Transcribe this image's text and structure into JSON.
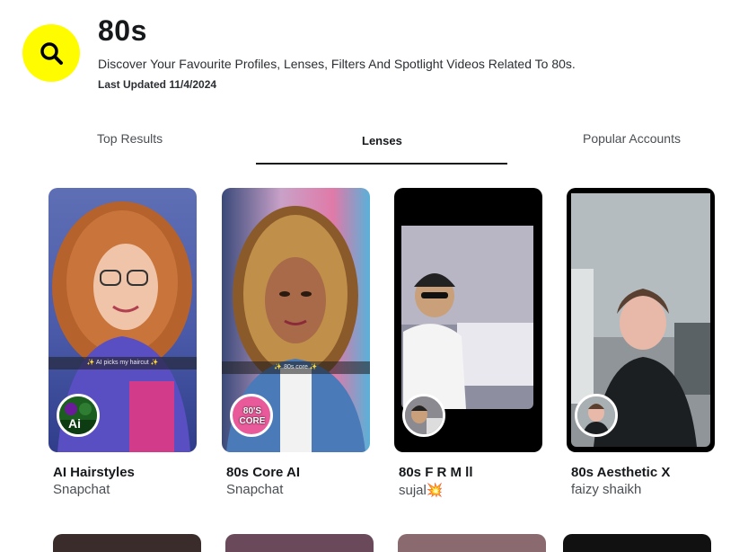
{
  "header": {
    "title": "80s",
    "subtitle": "Discover Your Favourite Profiles, Lenses, Filters And Spotlight Videos Related To 80s.",
    "last_updated": "Last Updated 11/4/2024",
    "search_icon": "search-icon"
  },
  "tabs": [
    {
      "label": "Top Results",
      "active": false
    },
    {
      "label": "Lenses",
      "active": true
    },
    {
      "label": "Popular Accounts",
      "active": false
    }
  ],
  "lenses": [
    {
      "name": "AI Hairstyles",
      "creator": "Snapchat",
      "caption": "✨ AI picks my haircut ✨",
      "avatar_text": "Ai"
    },
    {
      "name": "80s Core AI",
      "creator": "Snapchat",
      "caption": "✨ 80s core ✨",
      "avatar_text": "80'S CORE"
    },
    {
      "name": "80s F R M ll",
      "creator": "sujal💥",
      "caption": "",
      "avatar_text": ""
    },
    {
      "name": "80s Aesthetic X",
      "creator": "faizy shaikh",
      "caption": "",
      "avatar_text": ""
    }
  ],
  "colors": {
    "accent": "#fffc00",
    "text": "#16191c"
  }
}
